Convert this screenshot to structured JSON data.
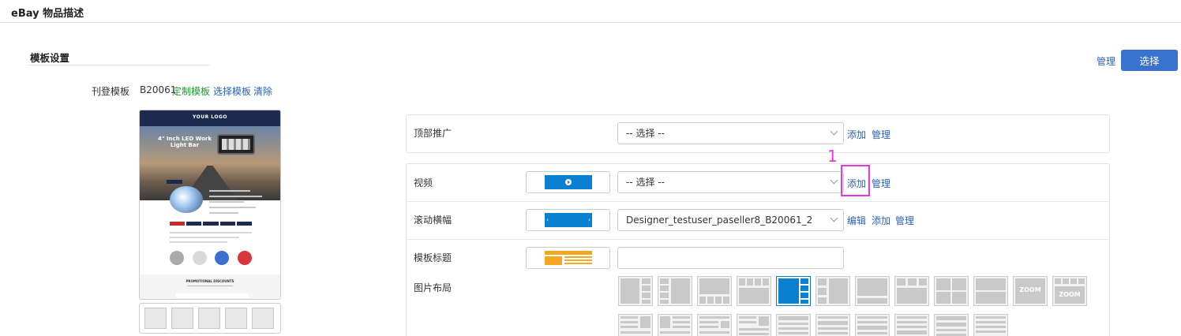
{
  "page": {
    "title": "eBay 物品描述"
  },
  "section": {
    "title": "模板设置"
  },
  "top_actions": {
    "manage": "管理",
    "select": "选择"
  },
  "template": {
    "label": "刊登模板",
    "code": "B20061",
    "custom": "定制模板",
    "choose": "选择模板",
    "clear": "清除"
  },
  "preview": {
    "logo": "YOUR LOGO",
    "hero_title": "4\" Inch LED Work Light Bar",
    "promo_title": "PROMOTIONAL DISCOUNTS"
  },
  "rows": {
    "top_promo": {
      "label": "顶部推广",
      "select": "-- 选择 --",
      "add": "添加",
      "manage": "管理"
    },
    "video": {
      "label": "视频",
      "select": "-- 选择 --",
      "add": "添加",
      "manage": "管理"
    },
    "banner": {
      "label": "滚动横幅",
      "select": "Designer_testuser_paseller8_B20061_2",
      "edit": "编辑",
      "add": "添加",
      "manage": "管理"
    },
    "tpl_title": {
      "label": "模板标题",
      "value": ""
    },
    "img_layout": {
      "label": "图片布局",
      "zoom": "ZOOM"
    }
  },
  "annotation": {
    "number": "1"
  },
  "colors": {
    "primary": "#3a72d0",
    "link": "#2d62b8",
    "green": "#1f9a2c",
    "accent_blue": "#0b7fd0",
    "annotation": "#e23ad8"
  }
}
